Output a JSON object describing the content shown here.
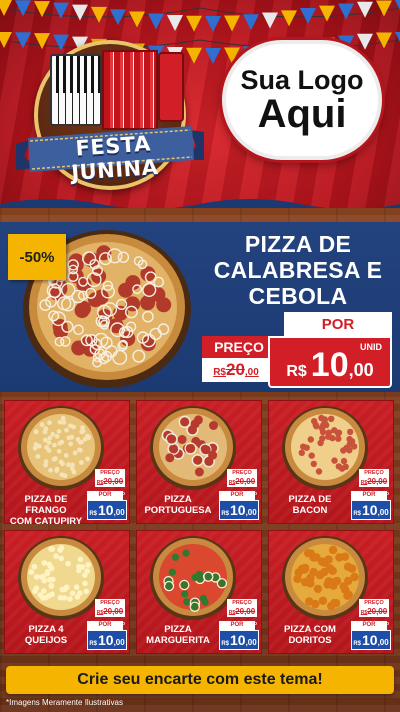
{
  "header": {
    "emblem_text": "FESTA JUNINA",
    "logo_line1": "Sua Logo",
    "logo_line2": "Aqui"
  },
  "colors": {
    "brand_red": "#d21e27",
    "navy": "#1c3a72",
    "yellow": "#f4b400",
    "price_blue": "#1d4ea8"
  },
  "featured": {
    "discount": "-50%",
    "title": "PIZZA DE\nCALABRESA E\nCEBOLA",
    "preco_label": "PREÇO",
    "old_currency": "R$",
    "old_int": "20",
    "old_dec": ",00",
    "por_label": "POR",
    "unid_label": "UNID",
    "new_currency": "R$",
    "new_int": "10",
    "new_dec": ",00"
  },
  "price_labels": {
    "preco": "PREÇO",
    "por": "POR",
    "unid": "UNID",
    "currency": "R$"
  },
  "products": [
    {
      "name": "PIZZA DE FRANGO\nCOM CATUPIRY",
      "old_price": "20,00",
      "new_int": "10",
      "new_dec": ",00",
      "icon": "pizza-frango-icon"
    },
    {
      "name": "PIZZA\nPORTUGUESA",
      "old_price": "20,00",
      "new_int": "10",
      "new_dec": ",00",
      "icon": "pizza-portuguesa-icon"
    },
    {
      "name": "PIZZA DE\nBACON",
      "old_price": "20,00",
      "new_int": "10",
      "new_dec": ",00",
      "icon": "pizza-bacon-icon"
    },
    {
      "name": "PIZZA 4\nQUEIJOS",
      "old_price": "20,00",
      "new_int": "10",
      "new_dec": ",00",
      "icon": "pizza-queijos-icon"
    },
    {
      "name": "PIZZA\nMARGUERITA",
      "old_price": "20,00",
      "new_int": "10",
      "new_dec": ",00",
      "icon": "pizza-marguerita-icon"
    },
    {
      "name": "PIZZA COM\nDORITOS",
      "old_price": "20,00",
      "new_int": "10",
      "new_dec": ",00",
      "icon": "pizza-doritos-icon"
    }
  ],
  "footer": {
    "cta": "Crie seu encarte com este tema!",
    "disclaimer": "*Imagens Meramente Ilustrativas"
  }
}
